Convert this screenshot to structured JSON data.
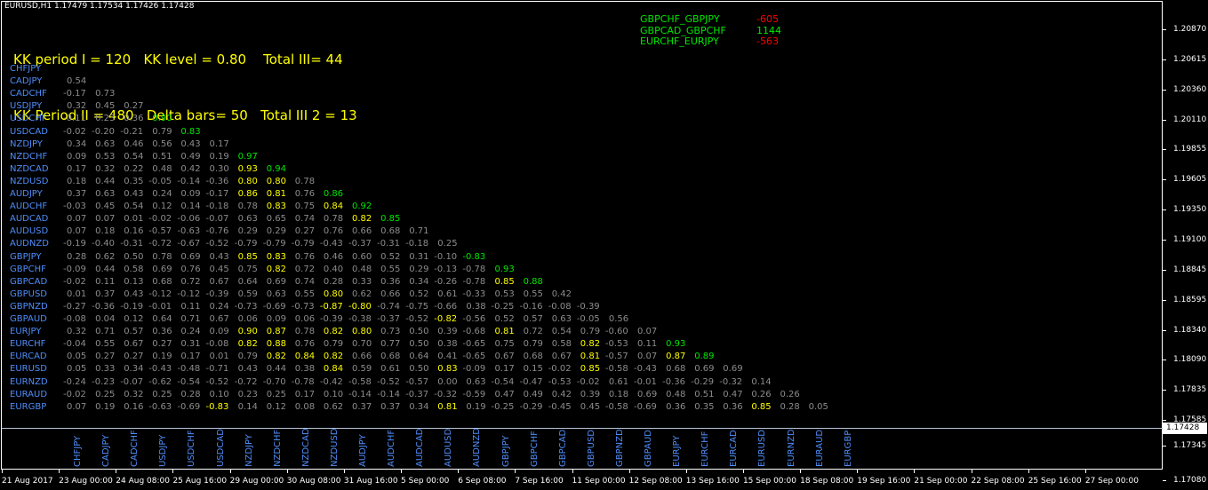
{
  "header": {
    "symbol_line": "EURUSD,H1  1.17479 1.17534 1.17426 1.17428"
  },
  "info": {
    "line1": "KK period I = 120   KK level = 0.80    Total III= 44",
    "line2": "KK Period II = 480   Delta bars= 50   Total III 2 = 13"
  },
  "pairs": [
    {
      "name": "GBPCHF_GBPJPY",
      "value": "-605",
      "color": "#ff0000"
    },
    {
      "name": "GBPCAD_GBPCHF",
      "value": "1144",
      "color": "#00e600"
    },
    {
      "name": "EURCHF_EURJPY",
      "value": "-563",
      "color": "#ff0000"
    }
  ],
  "colors": {
    "grey": "#8c8c8c",
    "green": "#00e600",
    "yellow": "#ffff00",
    "blue": "#4f8df9",
    "red": "#ff0000"
  },
  "matrix": {
    "symbols": [
      "CHFJPY",
      "CADJPY",
      "CADCHF",
      "USDJPY",
      "USDCHF",
      "USDCAD",
      "NZDJPY",
      "NZDCHF",
      "NZDCAD",
      "NZDUSD",
      "AUDJPY",
      "AUDCHF",
      "AUDCAD",
      "AUDUSD",
      "AUDNZD",
      "GBPJPY",
      "GBPCHF",
      "GBPCAD",
      "GBPUSD",
      "GBPNZD",
      "GBPAUD",
      "EURJPY",
      "EURCHF",
      "EURCAD",
      "EURUSD",
      "EURNZD",
      "EURAUD",
      "EURGBP"
    ],
    "rows": [
      [],
      [
        "0.54"
      ],
      [
        "-0.17",
        "0.73"
      ],
      [
        "0.32",
        "0.45",
        "0.27"
      ],
      [
        "-0.11",
        "0.23",
        "0.36",
        "0.90"
      ],
      [
        "-0.02",
        "-0.20",
        "-0.21",
        "0.79",
        "0.83"
      ],
      [
        "0.34",
        "0.63",
        "0.46",
        "0.56",
        "0.43",
        "0.17"
      ],
      [
        "0.09",
        "0.53",
        "0.54",
        "0.51",
        "0.49",
        "0.19",
        "0.97"
      ],
      [
        "0.17",
        "0.32",
        "0.22",
        "0.48",
        "0.42",
        "0.30",
        "0.93",
        "0.94"
      ],
      [
        "0.18",
        "0.44",
        "0.35",
        "-0.05",
        "-0.14",
        "-0.36",
        "0.80",
        "0.80",
        "0.78"
      ],
      [
        "0.37",
        "0.63",
        "0.43",
        "0.24",
        "0.09",
        "-0.17",
        "0.86",
        "0.81",
        "0.76",
        "0.86"
      ],
      [
        "-0.03",
        "0.45",
        "0.54",
        "0.12",
        "0.14",
        "-0.18",
        "0.78",
        "0.83",
        "0.75",
        "0.84",
        "0.92"
      ],
      [
        "0.07",
        "0.07",
        "0.01",
        "-0.02",
        "-0.06",
        "-0.07",
        "0.63",
        "0.65",
        "0.74",
        "0.78",
        "0.82",
        "0.85"
      ],
      [
        "0.07",
        "0.18",
        "0.16",
        "-0.57",
        "-0.63",
        "-0.76",
        "0.29",
        "0.29",
        "0.27",
        "0.76",
        "0.66",
        "0.68",
        "0.71"
      ],
      [
        "-0.19",
        "-0.40",
        "-0.31",
        "-0.72",
        "-0.67",
        "-0.52",
        "-0.79",
        "-0.79",
        "-0.79",
        "-0.43",
        "-0.37",
        "-0.31",
        "-0.18",
        "0.25"
      ],
      [
        "0.28",
        "0.62",
        "0.50",
        "0.78",
        "0.69",
        "0.43",
        "0.85",
        "0.83",
        "0.76",
        "0.46",
        "0.60",
        "0.52",
        "0.31",
        "-0.10",
        "-0.83"
      ],
      [
        "-0.09",
        "0.44",
        "0.58",
        "0.69",
        "0.76",
        "0.45",
        "0.75",
        "0.82",
        "0.72",
        "0.40",
        "0.48",
        "0.55",
        "0.29",
        "-0.13",
        "-0.78",
        "0.93"
      ],
      [
        "-0.02",
        "0.11",
        "0.13",
        "0.68",
        "0.72",
        "0.67",
        "0.64",
        "0.69",
        "0.74",
        "0.28",
        "0.33",
        "0.36",
        "0.34",
        "-0.26",
        "-0.78",
        "0.85",
        "0.88"
      ],
      [
        "0.01",
        "0.37",
        "0.43",
        "-0.12",
        "-0.12",
        "-0.39",
        "0.59",
        "0.63",
        "0.55",
        "0.80",
        "0.62",
        "0.66",
        "0.52",
        "0.61",
        "-0.33",
        "0.53",
        "0.55",
        "0.42"
      ],
      [
        "-0.27",
        "-0.36",
        "-0.19",
        "-0.01",
        "0.11",
        "0.24",
        "-0.73",
        "-0.69",
        "-0.73",
        "-0.87",
        "-0.80",
        "-0.74",
        "-0.75",
        "-0.66",
        "0.38",
        "-0.25",
        "-0.16",
        "-0.08",
        "-0.39"
      ],
      [
        "-0.08",
        "0.04",
        "0.12",
        "0.64",
        "0.71",
        "0.67",
        "0.06",
        "0.09",
        "0.06",
        "-0.39",
        "-0.38",
        "-0.37",
        "-0.52",
        "-0.82",
        "-0.56",
        "0.52",
        "0.57",
        "0.63",
        "-0.05",
        "0.56"
      ],
      [
        "0.32",
        "0.71",
        "0.57",
        "0.36",
        "0.24",
        "0.09",
        "0.90",
        "0.87",
        "0.78",
        "0.82",
        "0.80",
        "0.73",
        "0.50",
        "0.39",
        "-0.68",
        "0.81",
        "0.72",
        "0.54",
        "0.79",
        "-0.60",
        "0.07"
      ],
      [
        "-0.04",
        "0.55",
        "0.67",
        "0.27",
        "0.31",
        "-0.08",
        "0.82",
        "0.88",
        "0.76",
        "0.79",
        "0.70",
        "0.77",
        "0.50",
        "0.38",
        "-0.65",
        "0.75",
        "0.79",
        "0.58",
        "0.82",
        "-0.53",
        "0.11",
        "0.93"
      ],
      [
        "0.05",
        "0.27",
        "0.27",
        "0.19",
        "0.17",
        "0.01",
        "0.79",
        "0.82",
        "0.84",
        "0.82",
        "0.66",
        "0.68",
        "0.64",
        "0.41",
        "-0.65",
        "0.67",
        "0.68",
        "0.67",
        "0.81",
        "-0.57",
        "0.07",
        "0.87",
        "0.89"
      ],
      [
        "0.05",
        "0.33",
        "0.34",
        "-0.43",
        "-0.48",
        "-0.71",
        "0.43",
        "0.44",
        "0.38",
        "0.84",
        "0.59",
        "0.61",
        "0.50",
        "0.83",
        "-0.09",
        "0.17",
        "0.15",
        "-0.02",
        "0.85",
        "-0.58",
        "-0.43",
        "0.68",
        "0.69",
        "0.69"
      ],
      [
        "-0.24",
        "-0.23",
        "-0.07",
        "-0.62",
        "-0.54",
        "-0.52",
        "-0.72",
        "-0.70",
        "-0.78",
        "-0.42",
        "-0.58",
        "-0.52",
        "-0.57",
        "0.00",
        "0.63",
        "-0.54",
        "-0.47",
        "-0.53",
        "-0.02",
        "0.61",
        "-0.01",
        "-0.36",
        "-0.29",
        "-0.32",
        "0.14"
      ],
      [
        "-0.02",
        "0.25",
        "0.32",
        "0.25",
        "0.28",
        "0.10",
        "0.23",
        "0.25",
        "0.17",
        "0.10",
        "-0.14",
        "-0.14",
        "-0.37",
        "-0.32",
        "-0.59",
        "0.47",
        "0.49",
        "0.42",
        "0.39",
        "0.18",
        "0.69",
        "0.48",
        "0.51",
        "0.47",
        "0.26",
        "0.26"
      ],
      [
        "0.07",
        "0.19",
        "0.16",
        "-0.63",
        "-0.69",
        "-0.83",
        "0.14",
        "0.12",
        "0.08",
        "0.62",
        "0.37",
        "0.37",
        "0.34",
        "0.81",
        "0.19",
        "-0.25",
        "-0.29",
        "-0.45",
        "0.45",
        "-0.58",
        "-0.69",
        "0.36",
        "0.35",
        "0.36",
        "0.85",
        "0.28",
        "0.05"
      ]
    ]
  },
  "price_axis": {
    "labels": [
      "1.20870",
      "1.20615",
      "1.20360",
      "1.20110",
      "1.19855",
      "1.19605",
      "1.19350",
      "1.19100",
      "1.18845",
      "1.18595",
      "1.18340",
      "1.18090",
      "1.17835",
      "1.17585",
      "1.17345",
      "1.17080"
    ],
    "current": "1.17428"
  },
  "time_axis": {
    "labels": [
      "21 Aug 2017",
      "23 Aug 00:00",
      "24 Aug 08:00",
      "25 Aug 16:00",
      "29 Aug 00:00",
      "30 Aug 08:00",
      "31 Aug 16:00",
      "5 Sep 00:00",
      "6 Sep 08:00",
      "7 Sep 16:00",
      "11 Sep 00:00",
      "12 Sep 08:00",
      "13 Sep 16:00",
      "15 Sep 00:00",
      "18 Sep 08:00",
      "19 Sep 16:00",
      "21 Sep 00:00",
      "22 Sep 08:00",
      "25 Sep 16:00",
      "27 Sep 00:00"
    ]
  }
}
